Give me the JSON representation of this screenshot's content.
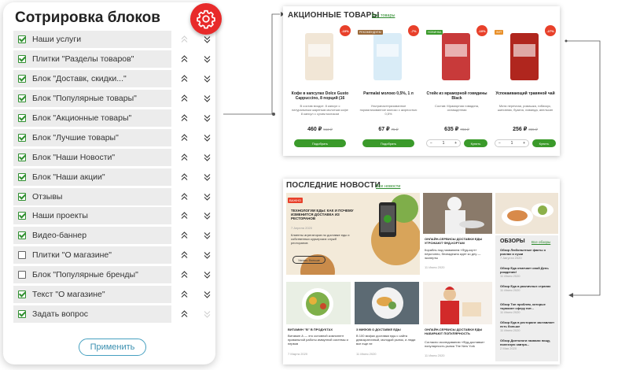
{
  "panel": {
    "title": "Сотрировка блоков",
    "apply_label": "Применить",
    "items": [
      {
        "label": "Наши услуги",
        "checked": true,
        "up_disabled": true,
        "down_disabled": false
      },
      {
        "label": "Плитки \"Разделы товаров\"",
        "checked": true,
        "up_disabled": false,
        "down_disabled": false
      },
      {
        "label": "Блок \"Доставк, скидки...\"",
        "checked": true,
        "up_disabled": false,
        "down_disabled": false
      },
      {
        "label": "Блок \"Популярные товары\"",
        "checked": true,
        "up_disabled": false,
        "down_disabled": false
      },
      {
        "label": "Блок \"Акционные товары\"",
        "checked": true,
        "up_disabled": false,
        "down_disabled": false
      },
      {
        "label": "Блок \"Лучшие товары\"",
        "checked": true,
        "up_disabled": false,
        "down_disabled": false
      },
      {
        "label": "Блок \"Наши Новости\"",
        "checked": true,
        "up_disabled": false,
        "down_disabled": false
      },
      {
        "label": "Блок \"Наши акции\"",
        "checked": true,
        "up_disabled": false,
        "down_disabled": false
      },
      {
        "label": "Отзывы",
        "checked": true,
        "up_disabled": false,
        "down_disabled": false
      },
      {
        "label": "Наши проекты",
        "checked": true,
        "up_disabled": false,
        "down_disabled": false
      },
      {
        "label": "Видео-баннер",
        "checked": true,
        "up_disabled": false,
        "down_disabled": false
      },
      {
        "label": "Плитки \"О магазине\"",
        "checked": false,
        "up_disabled": false,
        "down_disabled": false
      },
      {
        "label": "Блок \"Популярные бренды\"",
        "checked": false,
        "up_disabled": false,
        "down_disabled": false
      },
      {
        "label": "Текст \"О магазине\"",
        "checked": true,
        "up_disabled": false,
        "down_disabled": false
      },
      {
        "label": "Задать вопрос",
        "checked": true,
        "up_disabled": false,
        "down_disabled": true
      }
    ]
  },
  "promo": {
    "title": "АКЦИОННЫЕ ТОВАРЫ",
    "link": "Все товары",
    "products": [
      {
        "name": "Кофе в капсулах Dolce Gusto Cappuccino, 8 порций (16",
        "desc": "В состав входят: 8 капсул с натуральным жареным молотым кофе 8 капсул с сухим молоком",
        "price": "460 ₽",
        "old": "512 ₽",
        "discount": "-10%",
        "tag": "",
        "button": "Подобрать",
        "img_color": "#f1e6d6",
        "qty": ""
      },
      {
        "name": "Parmalat молоко 0,5%, 1 л",
        "desc": "Ультрапастеризованное нормализованное молоко с жирностью 0,5%",
        "price": "67 ₽",
        "old": "75 ₽",
        "discount": "-7%",
        "tag": "РЕКОМЕНДУЕМ",
        "button": "Подобрать",
        "img_color": "#d9ecf7",
        "qty": ""
      },
      {
        "name": "Стейк из мраморной говядины Black",
        "desc": "Состав: Мраморная говядина, охлажденная",
        "price": "635 ₽",
        "old": "703 ₽",
        "discount": "-10%",
        "tag": "НОВИНКА",
        "button": "Купить",
        "img_color": "#c83a3a",
        "qty": "1"
      },
      {
        "name": "Успокаивающий травяной чай",
        "desc": "Мята перечная, ромашка, гибискус, шиповник, бузина, лаванда, апельсин",
        "price": "256 ₽",
        "old": "365 ₽",
        "discount": "-27%",
        "tag": "ХИТ",
        "button": "Купить",
        "img_color": "#b0261e",
        "qty": "1"
      }
    ]
  },
  "news": {
    "title": "ПОСЛЕДНИЕ НОВОСТИ",
    "link": "Все новости",
    "featured": {
      "badge": "ВАЖНО",
      "head": "ТЕХНОЛОГИИ ЕДЫ: КАК И ПОЧЕМУ ИЗМЕНИТСЯ ДОСТАВКА ИЗ РЕСТОРАНОВ",
      "date": "7 Апреля 2020",
      "text": "Клиенты агрегаторов по доставке еды и собственных курьерских служб ресторанов",
      "button": "Узнать больше"
    },
    "tiles": [
      {
        "head": "ОНЛАЙН-СЕРВИСЫ ДОСТАВКИ ЕДЫ УГРОЖАЮТ ФУД-КОРТАМ",
        "text": "Корабль под названием «Фуд-корт» неуклонно, безнадежно идет ко дну — эксперты",
        "date": "11 Июня 2020"
      },
      {
        "head": "ВИТАМИН \"В\" В ПРОДУКТАХ",
        "text": "Витамин А — это основной компонент правильной работы иммунной системы и нервов",
        "date": "7 Марта 2020"
      },
      {
        "head": "3 МИФОВ О ДОСТАВКЕ ЕДЫ",
        "text": "В 100 мифах доставки еды с сайта демократичный, молодой рынок, и люди все еще не",
        "date": "11 Июня 2020"
      },
      {
        "head": "ОНЛАЙН-СЕРВИСЫ ДОСТАВКИ ЕДЫ НАБИРАЮТ ПОПУЛЯРНОСТЬ",
        "text": "Согласно исследованию «Фуд-доставки» популярность рынка The New York",
        "date": "11 Июня 2020"
      }
    ],
    "reviews_title": "ОБЗОРЫ",
    "reviews_link": "Все обзоры",
    "reviews": [
      {
        "text": "Обзор Любопытные факты о роллах и суши",
        "date": "7 Августа 2020"
      },
      {
        "text": "Обзор Еда отмечает свой День рождения!",
        "date": "11 Июня 2020"
      },
      {
        "text": "Обзор Еда в различных странах",
        "date": "11 Июня 2020"
      },
      {
        "text": "Обзор Топ проблем, которые тормозят сферу пит...",
        "date": "11 Июня 2020"
      },
      {
        "text": "Обзор Еда в ресторане заставляет есть больше",
        "date": "11 Июня 2020"
      },
      {
        "text": "Обзор Диетологи назвали пищу, полезную завтра...",
        "date": "2 Мая 2020"
      }
    ]
  },
  "colors": {
    "accent_green": "#3a9a2a",
    "gear_red": "#e82a2a",
    "apply_border": "#46a0c0"
  }
}
